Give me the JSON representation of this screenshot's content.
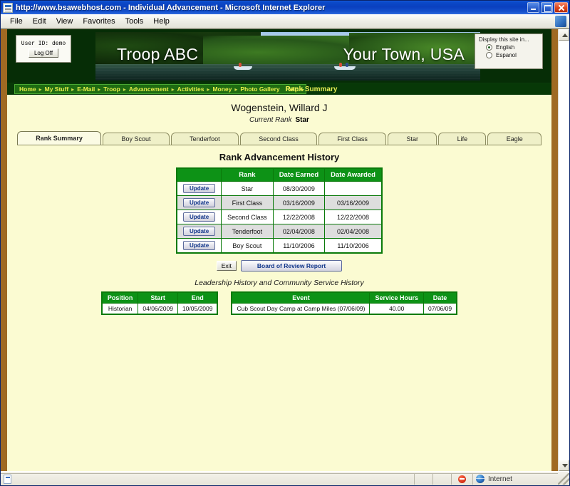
{
  "window": {
    "title": "http://www.bsawebhost.com - Individual Advancement - Microsoft Internet Explorer",
    "icon": "ie-document-icon",
    "minimize_label": "Minimize",
    "maximize_label": "Maximize",
    "close_label": "Close"
  },
  "menubar": {
    "items": [
      "File",
      "Edit",
      "View",
      "Favorites",
      "Tools",
      "Help"
    ]
  },
  "header": {
    "user_id_label": "User ID: demo",
    "logoff_label": "Log Off",
    "banner_left": "Troop ABC",
    "banner_right": "Your Town, USA",
    "language": {
      "label": "Display this site in...",
      "options": [
        {
          "label": "English",
          "selected": true
        },
        {
          "label": "Espanol",
          "selected": false
        }
      ]
    }
  },
  "nav": {
    "items": [
      "Home",
      "My Stuff",
      "E-Mail",
      "Troop",
      "Advancement",
      "Activities",
      "Money",
      "Photo Gallery",
      "Help"
    ],
    "separator": "▸",
    "page_title": "Rank Summary"
  },
  "scout": {
    "name": "Wogenstein, Willard J",
    "current_rank_label": "Current Rank",
    "current_rank_value": "Star"
  },
  "tabs": [
    {
      "label": "Rank Summary",
      "active": true
    },
    {
      "label": "Boy Scout",
      "active": false
    },
    {
      "label": "Tenderfoot",
      "active": false
    },
    {
      "label": "Second Class",
      "active": false
    },
    {
      "label": "First Class",
      "active": false
    },
    {
      "label": "Star",
      "active": false
    },
    {
      "label": "Life",
      "active": false
    },
    {
      "label": "Eagle",
      "active": false
    }
  ],
  "rank_history": {
    "title": "Rank Advancement History",
    "columns": [
      "",
      "Rank",
      "Date Earned",
      "Date Awarded"
    ],
    "update_label": "Update",
    "rows": [
      {
        "rank": "Star",
        "date_earned": "08/30/2009",
        "date_awarded": ""
      },
      {
        "rank": "First Class",
        "date_earned": "03/16/2009",
        "date_awarded": "03/16/2009"
      },
      {
        "rank": "Second Class",
        "date_earned": "12/22/2008",
        "date_awarded": "12/22/2008"
      },
      {
        "rank": "Tenderfoot",
        "date_earned": "02/04/2008",
        "date_awarded": "02/04/2008"
      },
      {
        "rank": "Boy Scout",
        "date_earned": "11/10/2006",
        "date_awarded": "11/10/2006"
      }
    ]
  },
  "actions": {
    "exit_label": "Exit",
    "board_of_review_label": "Board of Review Report"
  },
  "leadership": {
    "section_title": "Leadership History and Community Service History",
    "position_columns": [
      "Position",
      "Start",
      "End"
    ],
    "position_rows": [
      {
        "position": "Historian",
        "start": "04/06/2009",
        "end": "10/05/2009"
      }
    ],
    "service_columns": [
      "Event",
      "Service Hours",
      "Date"
    ],
    "service_rows": [
      {
        "event": "Cub Scout Day Camp at Camp Miles (07/06/09)",
        "hours": "40.00",
        "date": "07/06/09"
      }
    ]
  },
  "statusbar": {
    "zone": "Internet",
    "restricted_icon": "no-entry-icon",
    "zone_icon": "globe-icon"
  },
  "colors": {
    "titlebar_blue": "#0a40bf",
    "page_bg": "#fbfbd2",
    "header_dark_green": "#062d06",
    "table_header_green": "#0d9216",
    "table_border_green": "#0a7a0a",
    "nav_link_yellow": "#e8ef4a",
    "browser_frame_brown": "#9f6a23"
  }
}
